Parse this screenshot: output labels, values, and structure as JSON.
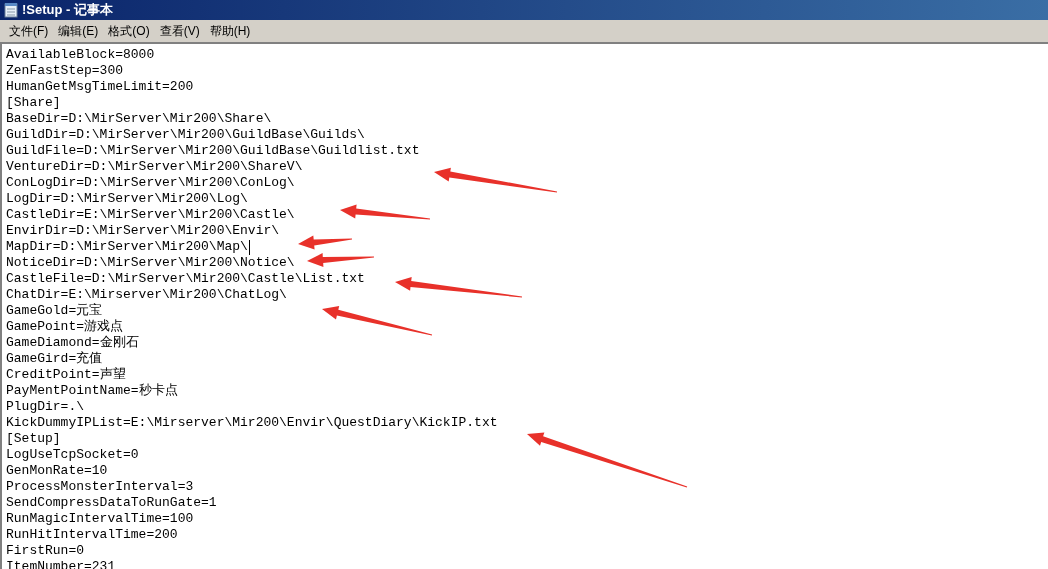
{
  "window": {
    "title": "!Setup - 记事本"
  },
  "menu": [
    "文件(F)",
    "编辑(E)",
    "格式(O)",
    "查看(V)",
    "帮助(H)"
  ],
  "lines": [
    {
      "text": "AvailableBlock=8000",
      "cursor": false
    },
    {
      "text": "ZenFastStep=300",
      "cursor": false
    },
    {
      "text": "HumanGetMsgTimeLimit=200",
      "cursor": false
    },
    {
      "text": "[Share]",
      "cursor": false
    },
    {
      "text": "BaseDir=D:\\MirServer\\Mir200\\Share\\",
      "cursor": false
    },
    {
      "text": "GuildDir=D:\\MirServer\\Mir200\\GuildBase\\Guilds\\",
      "cursor": false
    },
    {
      "text": "GuildFile=D:\\MirServer\\Mir200\\GuildBase\\Guildlist.txt",
      "cursor": false
    },
    {
      "text": "VentureDir=D:\\MirServer\\Mir200\\ShareV\\",
      "cursor": false
    },
    {
      "text": "ConLogDir=D:\\MirServer\\Mir200\\ConLog\\",
      "cursor": false
    },
    {
      "text": "LogDir=D:\\MirServer\\Mir200\\Log\\",
      "cursor": false
    },
    {
      "text": "CastleDir=E:\\MirServer\\Mir200\\Castle\\",
      "cursor": false
    },
    {
      "text": "EnvirDir=D:\\MirServer\\Mir200\\Envir\\",
      "cursor": false
    },
    {
      "text": "MapDir=D:\\MirServer\\Mir200\\Map\\",
      "cursor": true
    },
    {
      "text": "NoticeDir=D:\\MirServer\\Mir200\\Notice\\",
      "cursor": false
    },
    {
      "text": "CastleFile=D:\\MirServer\\Mir200\\Castle\\List.txt",
      "cursor": false
    },
    {
      "text": "ChatDir=E:\\Mirserver\\Mir200\\ChatLog\\",
      "cursor": false
    },
    {
      "text": "GameGold=元宝",
      "cursor": false
    },
    {
      "text": "GamePoint=游戏点",
      "cursor": false
    },
    {
      "text": "GameDiamond=金刚石",
      "cursor": false
    },
    {
      "text": "GameGird=充值",
      "cursor": false
    },
    {
      "text": "CreditPoint=声望",
      "cursor": false
    },
    {
      "text": "PayMentPointName=秒卡点",
      "cursor": false
    },
    {
      "text": "PlugDir=.\\",
      "cursor": false
    },
    {
      "text": "KickDummyIPList=E:\\Mirserver\\Mir200\\Envir\\QuestDiary\\KickIP.txt",
      "cursor": false
    },
    {
      "text": "[Setup]",
      "cursor": false
    },
    {
      "text": "LogUseTcpSocket=0",
      "cursor": false
    },
    {
      "text": "GenMonRate=10",
      "cursor": false
    },
    {
      "text": "ProcessMonsterInterval=3",
      "cursor": false
    },
    {
      "text": "SendCompressDataToRunGate=1",
      "cursor": false
    },
    {
      "text": "RunMagicIntervalTime=100",
      "cursor": false
    },
    {
      "text": "RunHitIntervalTime=200",
      "cursor": false
    },
    {
      "text": "FirstRun=0",
      "cursor": false
    },
    {
      "text": "ItemNumber=231",
      "cursor": false
    }
  ]
}
